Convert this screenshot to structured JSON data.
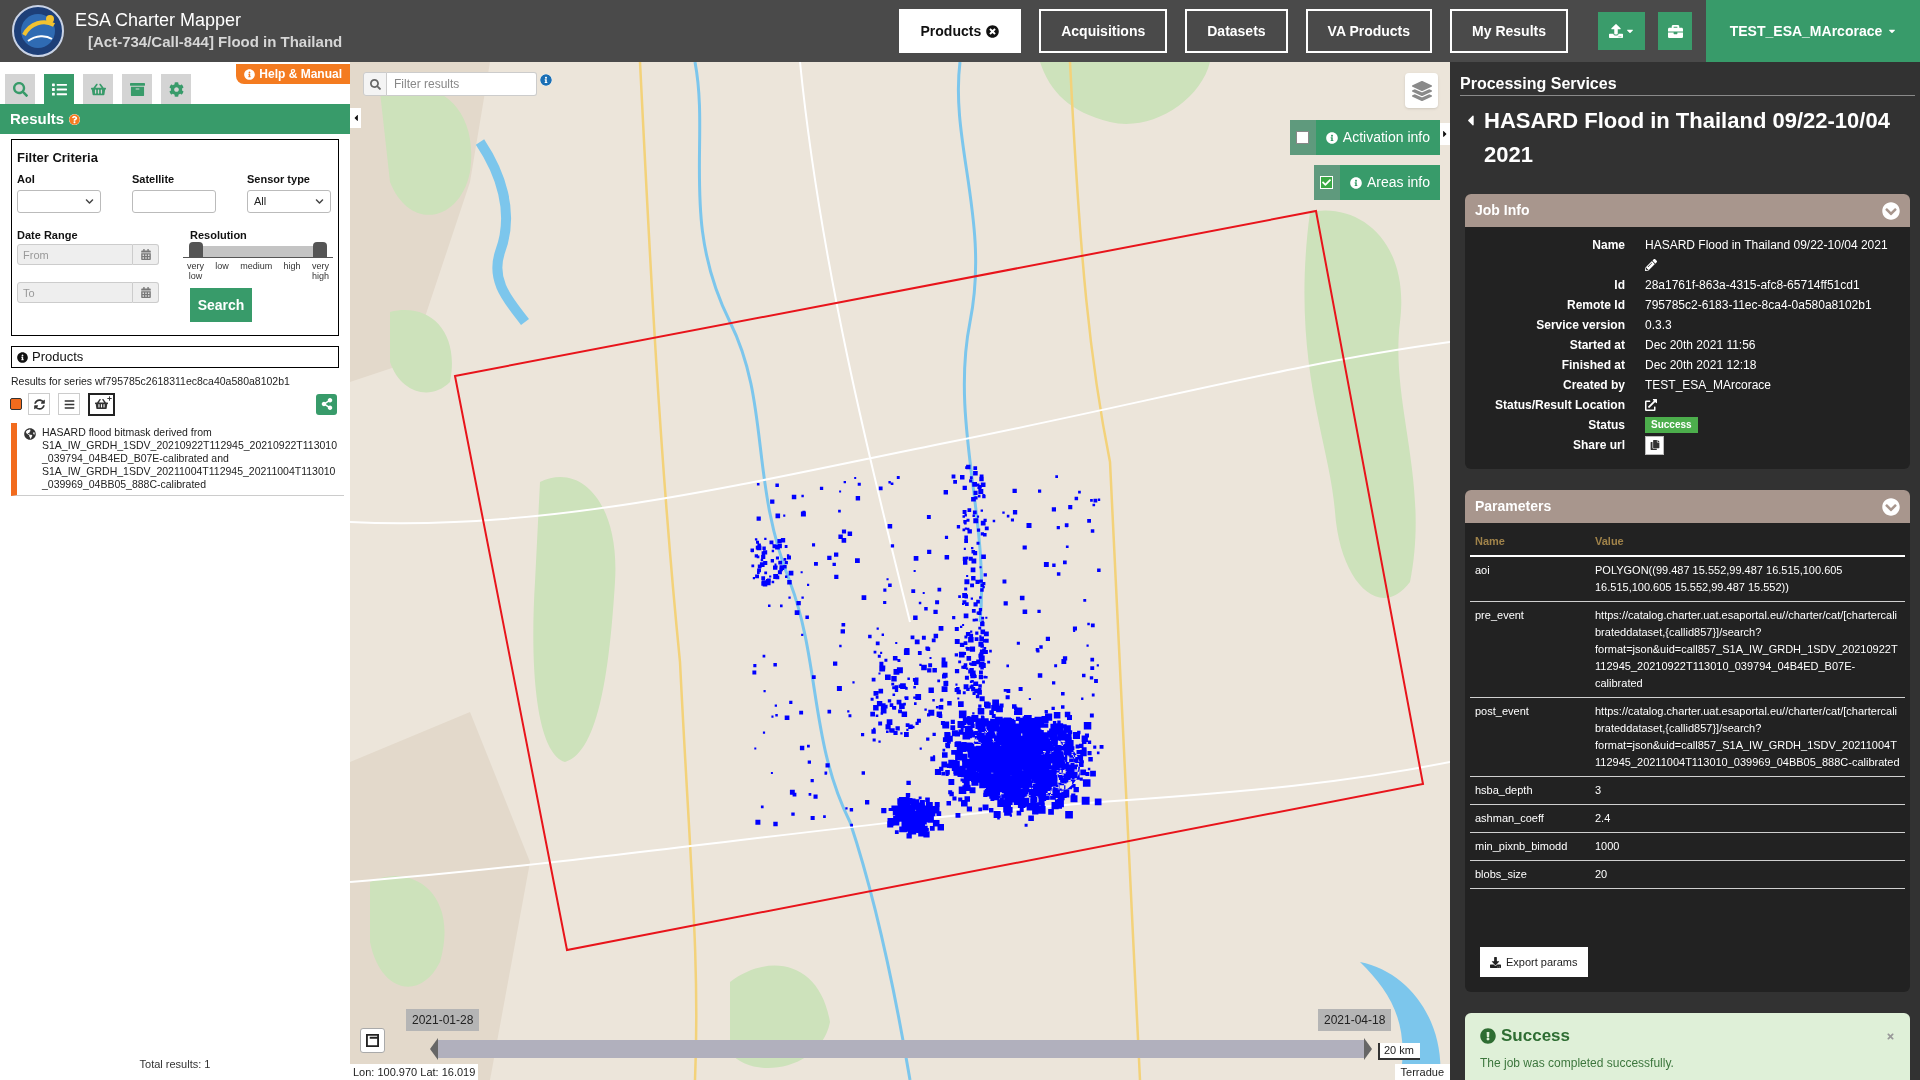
{
  "header": {
    "title": "ESA Charter Mapper",
    "subtitle": "[Act-734/Call-844] Flood in Thailand",
    "nav": [
      {
        "label": "Products",
        "selected": true,
        "closable": true
      },
      {
        "label": "Acquisitions",
        "selected": false,
        "closable": false
      },
      {
        "label": "Datasets",
        "selected": false,
        "closable": false
      },
      {
        "label": "VA Products",
        "selected": false,
        "closable": false
      },
      {
        "label": "My Results",
        "selected": false,
        "closable": false
      }
    ],
    "user": "TEST_ESA_MArcorace"
  },
  "sidebar": {
    "tabs": [
      {
        "kind": "search",
        "selected": false
      },
      {
        "kind": "list",
        "selected": true
      },
      {
        "kind": "basket",
        "selected": false
      },
      {
        "kind": "archive",
        "selected": false
      },
      {
        "kind": "settings",
        "selected": false
      }
    ],
    "help_link": "Help & Manual",
    "section_title": "Results",
    "filter": {
      "title": "Filter Criteria",
      "aoi": {
        "label": "AoI"
      },
      "satellite": {
        "label": "Satellite"
      },
      "sensor_type": {
        "label": "Sensor type",
        "value": "All"
      },
      "date_range": {
        "label": "Date Range",
        "from": {
          "placeholder": "From"
        },
        "to": {
          "placeholder": "To"
        }
      },
      "resolution": {
        "label": "Resolution",
        "handles": [
          {
            "level": 0
          },
          {
            "level": 1
          }
        ],
        "ticks": [
          "very low",
          "low",
          "medium",
          "high",
          "very high"
        ]
      },
      "search_button": "Search"
    },
    "products": {
      "title": "Products",
      "series": "Results for series wf795785c2618311ec8ca40a580a8102b1",
      "items": [
        {
          "text": "HASARD flood bitmask derived from S1A_IW_GRDH_1SDV_20210922T112945_20210922T113010_039794_04B4ED_B07E-calibrated and S1A_IW_GRDH_1SDV_20211004T112945_20211004T113010_039969_04BB05_888C-calibrated",
          "selected": true
        }
      ],
      "total": "Total results: 1"
    }
  },
  "map": {
    "search": {
      "placeholder": "Filter results"
    },
    "overlays": [
      {
        "label": "Activation info",
        "checked": false
      },
      {
        "label": "Areas info",
        "checked": true
      }
    ],
    "timeline": {
      "start": "2021-01-28",
      "end": "2021-04-18",
      "handles": [
        {
          "level": 0
        },
        {
          "level": 1
        }
      ]
    },
    "scale": "20 km",
    "coordinates": "Lon: 100.970 Lat: 16.019",
    "attribution": "Terradue"
  },
  "processing": {
    "title": "Processing Services",
    "job_title": "HASARD Flood in Thailand 09/22-10/04 2021",
    "job_info": {
      "title": "Job Info",
      "expanded": true,
      "rows": [
        {
          "label": "Name",
          "value": "HASARD Flood in Thailand 09/22-10/04 2021",
          "kind": "editable"
        },
        {
          "label": "Id",
          "value": "28a1761f-863a-4315-afc8-65714ff51cd1",
          "kind": "text"
        },
        {
          "label": "Remote Id",
          "value": "795785c2-6183-11ec-8ca4-0a580a8102b1",
          "kind": "text"
        },
        {
          "label": "Service version",
          "value": "0.3.3",
          "kind": "text"
        },
        {
          "label": "Started at",
          "value": "Dec 20th 2021 11:56",
          "kind": "text"
        },
        {
          "label": "Finished at",
          "value": "Dec 20th 2021 12:18",
          "kind": "text"
        },
        {
          "label": "Created by",
          "value": "TEST_ESA_MArcorace",
          "kind": "text"
        },
        {
          "label": "Status/Result Location",
          "kind": "link"
        },
        {
          "label": "Status",
          "value": "Success",
          "kind": "badge"
        },
        {
          "label": "Share url",
          "kind": "copy"
        }
      ]
    },
    "parameters": {
      "title": "Parameters",
      "expanded": true,
      "columns": [
        "Name",
        "Value"
      ],
      "rows": [
        {
          "name": "aoi",
          "value": "POLYGON((99.487 15.552,99.487 16.515,100.605 16.515,100.605 15.552,99.487 15.552))"
        },
        {
          "name": "pre_event",
          "value": "https://catalog.charter.uat.esaportal.eu//charter/cat/[chartercalibrateddataset,{callid857}]/search?format=json&uid=call857_S1A_IW_GRDH_1SDV_20210922T112945_20210922T113010_039794_04B4ED_B07E-calibrated"
        },
        {
          "name": "post_event",
          "value": "https://catalog.charter.uat.esaportal.eu//charter/cat/[chartercalibrateddataset,{callid857}]/search?format=json&uid=call857_S1A_IW_GRDH_1SDV_20211004T112945_20211004T113010_039969_04BB05_888C-calibrated"
        },
        {
          "name": "hsba_depth",
          "value": "3"
        },
        {
          "name": "ashman_coeff",
          "value": "2.4"
        },
        {
          "name": "min_pixnb_bimodd",
          "value": "1000"
        },
        {
          "name": "blobs_size",
          "value": "20"
        }
      ],
      "export_button": "Export params"
    },
    "alert": {
      "title": "Success",
      "message": "The job was completed successfully."
    }
  }
}
